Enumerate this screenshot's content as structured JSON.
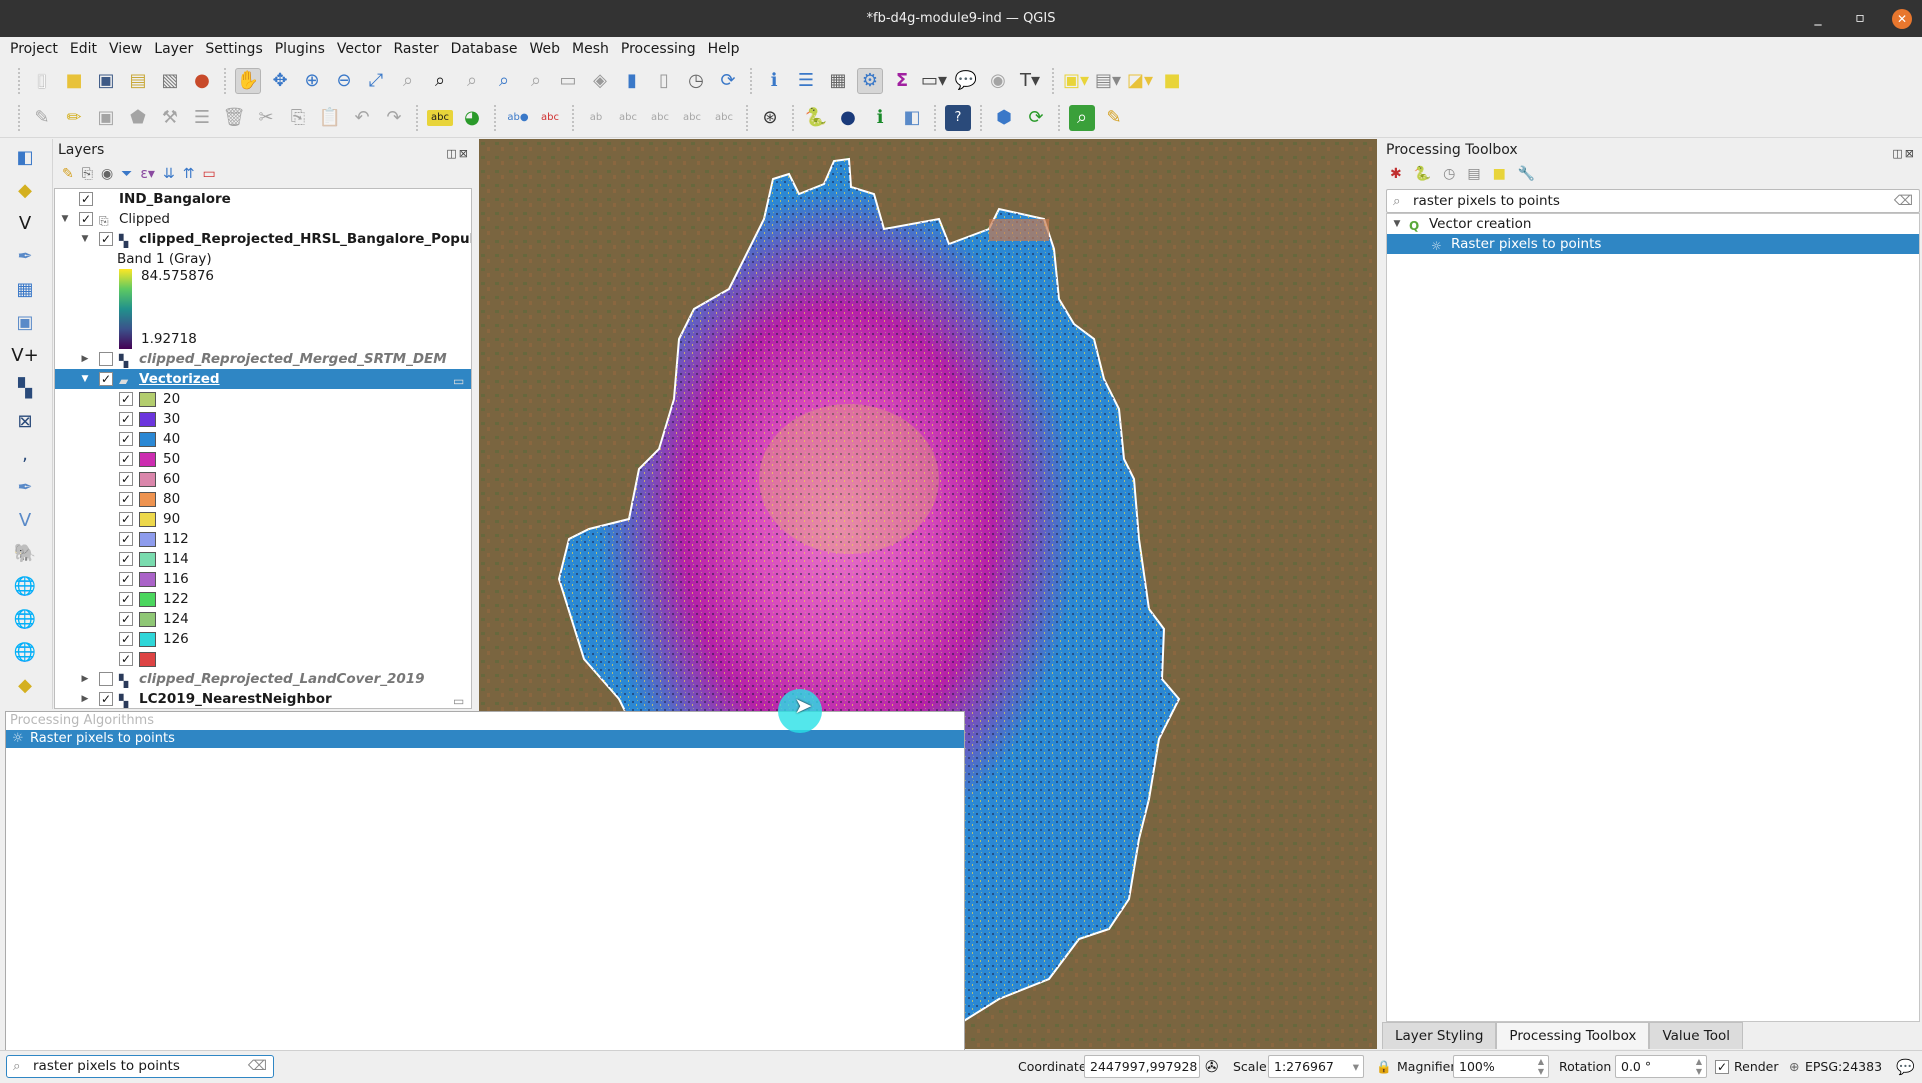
{
  "window": {
    "title": "*fb-d4g-module9-ind — QGIS",
    "minimize": "_",
    "maximize": "▫",
    "close": "✕"
  },
  "menu": [
    "Project",
    "Edit",
    "View",
    "Layer",
    "Settings",
    "Plugins",
    "Vector",
    "Raster",
    "Database",
    "Web",
    "Mesh",
    "Processing",
    "Help"
  ],
  "layers_panel": {
    "title": "Layers",
    "layers": [
      {
        "name": "IND_Bangalore",
        "checked": true
      },
      {
        "name": "Clipped",
        "checked": true,
        "group": true
      },
      {
        "name": "clipped_Reprojected_HRSL_Bangalore_Populat",
        "checked": true
      },
      {
        "band": "Band 1 (Gray)",
        "max": "84.575876",
        "min": "1.92718"
      },
      {
        "name": "clipped_Reprojected_Merged_SRTM_DEM",
        "checked": false
      },
      {
        "name": "Vectorized",
        "checked": true,
        "selected": true
      },
      {
        "name": "clipped_Reprojected_LandCover_2019",
        "checked": false
      },
      {
        "name": "LC2019_NearestNeighbor",
        "checked": true
      }
    ],
    "legend_band": "Band 1 (Gray)",
    "legend_max": "84.575876",
    "legend_min": "1.92718",
    "classes": [
      {
        "label": "20",
        "color": "#b3cd6e"
      },
      {
        "label": "30",
        "color": "#6b35dd"
      },
      {
        "label": "40",
        "color": "#2b88d4"
      },
      {
        "label": "50",
        "color": "#cc2db0"
      },
      {
        "label": "60",
        "color": "#da86ab"
      },
      {
        "label": "80",
        "color": "#ee9350"
      },
      {
        "label": "90",
        "color": "#edd84b"
      },
      {
        "label": "112",
        "color": "#8e9ced"
      },
      {
        "label": "114",
        "color": "#79dbae"
      },
      {
        "label": "116",
        "color": "#aa63c8"
      },
      {
        "label": "122",
        "color": "#4bd65e"
      },
      {
        "label": "124",
        "color": "#8fc775"
      },
      {
        "label": "126",
        "color": "#2fd6d8"
      },
      {
        "label": "",
        "color": "#dd4444"
      }
    ]
  },
  "toolbox": {
    "title": "Processing Toolbox",
    "search_value": "raster pixels to points",
    "group": "Vector creation",
    "algorithm": "Raster pixels to points"
  },
  "bottom_tabs": [
    "Layer Styling",
    "Processing Toolbox",
    "Value Tool"
  ],
  "popup": {
    "header": "Processing Algorithms",
    "item": "Raster pixels to points"
  },
  "locator": {
    "value": "raster pixels to points"
  },
  "status": {
    "coordinate_label": "Coordinate",
    "coordinate": "2447997,997928",
    "scale_label": "Scale",
    "scale": "1:276967",
    "magnifier_label": "Magnifier",
    "magnifier": "100%",
    "rotation_label": "Rotation",
    "rotation": "0.0 °",
    "render_label": "Render",
    "crs": "EPSG:24383"
  }
}
